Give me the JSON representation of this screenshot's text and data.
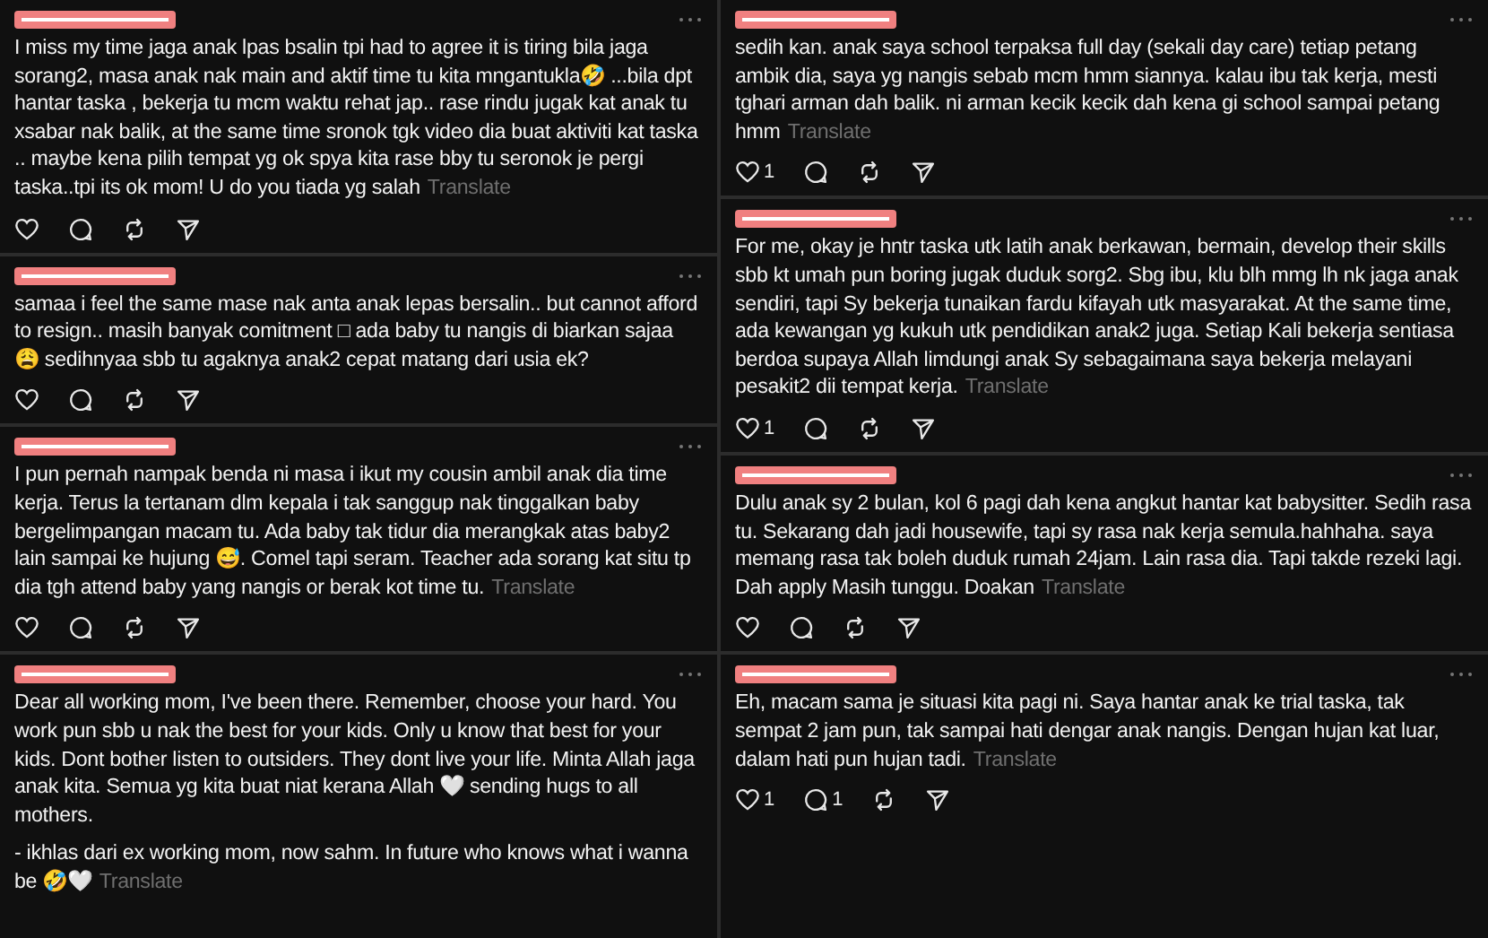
{
  "columns": [
    {
      "posts": [
        {
          "body": "I miss my time jaga anak lpas bsalin tpi had to agree it is tiring bila jaga sorang2, masa anak nak main and aktif time tu kita mngantukla🤣 ...bila dpt hantar taska , bekerja tu mcm waktu rehat jap.. rase rindu jugak kat anak tu xsabar nak balik, at the same time sronok tgk video dia buat aktiviti kat taska .. maybe kena pilih tempat yg ok spya kita rase bby tu seronok je pergi taska..tpi its ok mom! U do you tiada yg salah",
          "translate": "Translate",
          "actions": [
            {
              "kind": "like"
            },
            {
              "kind": "comment"
            },
            {
              "kind": "repost"
            },
            {
              "kind": "share"
            }
          ]
        },
        {
          "body": "samaa i feel the same mase nak anta anak lepas bersalin.. but cannot afford to resign.. masih banyak comitment □ ada baby tu nangis di biarkan sajaa 😩 sedihnyaa sbb tu agaknya anak2 cepat matang dari usia ek?",
          "actions": [
            {
              "kind": "like"
            },
            {
              "kind": "comment"
            },
            {
              "kind": "repost"
            },
            {
              "kind": "share"
            }
          ]
        },
        {
          "body": "I pun pernah nampak benda ni masa i ikut my cousin ambil anak dia time kerja. Terus la tertanam dlm kepala i tak sanggup nak tinggalkan baby bergelimpangan macam tu. Ada baby tak tidur dia merangkak atas baby2 lain sampai ke hujung 😅. Comel tapi seram. Teacher ada sorang kat situ tp dia tgh attend baby yang nangis or berak kot time tu.",
          "translate": "Translate",
          "actions": [
            {
              "kind": "like"
            },
            {
              "kind": "comment"
            },
            {
              "kind": "repost"
            },
            {
              "kind": "share"
            }
          ]
        },
        {
          "body": "Dear all working mom, I've been there. Remember, choose your hard. You work pun sbb u nak the best for your kids. Only u know that best for your kids. Dont bother listen to outsiders. They dont live your life. Minta Allah jaga anak kita. Semua yg kita buat niat kerana Allah 🤍 sending hugs to all mothers.",
          "footer": "- ikhlas dari ex working mom, now sahm. In future who knows what i wanna be 🤣🤍",
          "translate": "Translate"
        }
      ]
    },
    {
      "posts": [
        {
          "body": "sedih kan. anak saya school terpaksa full day (sekali day care) tetiap petang ambik dia, saya yg nangis sebab mcm hmm siannya. kalau ibu tak kerja, mesti tghari arman dah balik. ni arman kecik kecik dah kena gi school sampai petang hmm",
          "translate": "Translate",
          "actions": [
            {
              "kind": "like",
              "count": "1"
            },
            {
              "kind": "comment"
            },
            {
              "kind": "repost"
            },
            {
              "kind": "share"
            }
          ]
        },
        {
          "body": "For me, okay je hntr taska utk latih anak berkawan, bermain, develop their skills sbb kt umah pun boring jugak duduk sorg2. Sbg ibu, klu blh mmg lh nk jaga anak sendiri, tapi Sy bekerja tunaikan fardu kifayah utk masyarakat. At the same time, ada kewangan yg kukuh utk pendidikan anak2 juga. Setiap Kali bekerja sentiasa berdoa supaya Allah limdungi anak Sy sebagaimana saya bekerja melayani pesakit2 dii tempat kerja.",
          "translate": "Translate",
          "actions": [
            {
              "kind": "like",
              "count": "1"
            },
            {
              "kind": "comment"
            },
            {
              "kind": "repost"
            },
            {
              "kind": "share"
            }
          ]
        },
        {
          "body": "Dulu anak sy 2 bulan, kol 6 pagi dah kena angkut hantar kat babysitter. Sedih rasa tu. Sekarang dah jadi housewife, tapi sy rasa nak kerja semula.hahhaha. saya memang rasa tak boleh duduk rumah 24jam. Lain rasa dia. Tapi takde rezeki lagi. Dah apply Masih tunggu. Doakan",
          "translate": "Translate",
          "actions": [
            {
              "kind": "like"
            },
            {
              "kind": "comment"
            },
            {
              "kind": "repost"
            },
            {
              "kind": "share"
            }
          ]
        },
        {
          "body": "Eh, macam sama je situasi kita pagi ni. Saya hantar anak ke trial taska, tak sempat 2 jam pun, tak sampai hati dengar anak nangis. Dengan hujan kat luar, dalam hati pun hujan tadi.",
          "translate": "Translate",
          "actions": [
            {
              "kind": "like",
              "count": "1"
            },
            {
              "kind": "comment",
              "count": "1"
            },
            {
              "kind": "repost"
            },
            {
              "kind": "share"
            }
          ]
        }
      ]
    }
  ]
}
